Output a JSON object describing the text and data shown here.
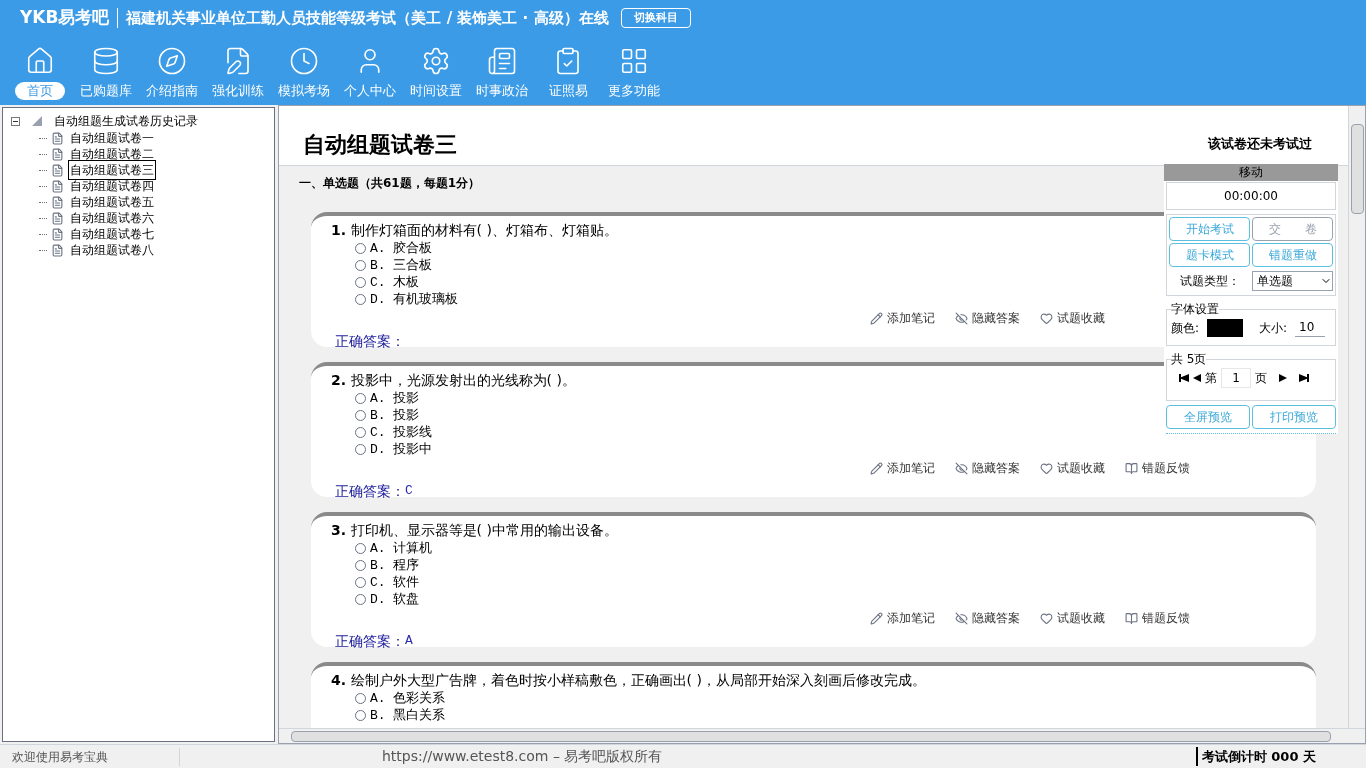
{
  "header": {
    "logo": "YKB易考吧",
    "title": "福建机关事业单位工勤人员技能等级考试（美工 / 装饰美工 · 高级）在线",
    "switch_button": "切换科目"
  },
  "nav": [
    {
      "label": "首页",
      "selected": true
    },
    {
      "label": "已购题库",
      "selected": false
    },
    {
      "label": "介绍指南",
      "selected": false
    },
    {
      "label": "强化训练",
      "selected": false
    },
    {
      "label": "模拟考场",
      "selected": false
    },
    {
      "label": "个人中心",
      "selected": false
    },
    {
      "label": "时间设置",
      "selected": false
    },
    {
      "label": "时事政治",
      "selected": false
    },
    {
      "label": "证照易",
      "selected": false
    },
    {
      "label": "更多功能",
      "selected": false
    }
  ],
  "tree": {
    "label": "自动组题生成试卷历史记录",
    "expanded": true,
    "children": [
      {
        "label": "自动组题试卷一",
        "selected": false
      },
      {
        "label": "自动组题试卷二",
        "selected": false
      },
      {
        "label": "自动组题试卷三",
        "selected": true
      },
      {
        "label": "自动组题试卷四",
        "selected": false
      },
      {
        "label": "自动组题试卷五",
        "selected": false
      },
      {
        "label": "自动组题试卷六",
        "selected": false
      },
      {
        "label": "自动组题试卷七",
        "selected": false
      },
      {
        "label": "自动组题试卷八",
        "selected": false
      }
    ]
  },
  "paper": {
    "title": "自动组题试卷三",
    "status": "该试卷还未考试过",
    "section": "一、单选题（共61题，每题1分）",
    "questions": [
      {
        "number": "1.",
        "text": "制作灯箱面的材料有( )、灯箱布、灯箱贴。",
        "options": [
          {
            "label": "A. 胶合板",
            "selected": false
          },
          {
            "label": "B. 三合板",
            "selected": false
          },
          {
            "label": "C. 木板",
            "selected": false
          },
          {
            "label": "D. 有机玻璃板",
            "selected": false
          }
        ],
        "actions": [
          "添加笔记",
          "隐藏答案",
          "试题收藏"
        ],
        "answer_label": "正确答案："
      },
      {
        "number": "2.",
        "text": "投影中，光源发射出的光线称为( )。",
        "options": [
          {
            "label": "A. 投影",
            "selected": false
          },
          {
            "label": "B. 投影",
            "selected": false
          },
          {
            "label": "C. 投影线",
            "selected": false
          },
          {
            "label": "D. 投影中",
            "selected": false
          }
        ],
        "actions": [
          "添加笔记",
          "隐藏答案",
          "试题收藏",
          "错题反馈"
        ],
        "answer_label": "正确答案：",
        "answer": "C"
      },
      {
        "number": "3.",
        "text": "打印机、显示器等是( )中常用的输出设备。",
        "options": [
          {
            "label": "A. 计算机",
            "selected": false
          },
          {
            "label": "B. 程序",
            "selected": false
          },
          {
            "label": "C. 软件",
            "selected": false
          },
          {
            "label": "D. 软盘",
            "selected": false
          }
        ],
        "actions": [
          "添加笔记",
          "隐藏答案",
          "试题收藏",
          "错题反馈"
        ],
        "answer_label": "正确答案：",
        "answer": "A"
      },
      {
        "number": "4.",
        "text": "绘制户外大型广告牌，着色时按小样稿敷色，正确画出( )，从局部开始深入刻画后修改完成。",
        "options": [
          {
            "label": "A. 色彩关系",
            "selected": false
          },
          {
            "label": "B. 黑白关系",
            "selected": false
          }
        ]
      }
    ]
  },
  "panel": {
    "move": "移动",
    "timer": "00:00:00",
    "buttons": [
      {
        "label": "开始考试",
        "disabled": false
      },
      {
        "label": "交　　卷",
        "disabled": true
      },
      {
        "label": "题卡模式",
        "disabled": false
      },
      {
        "label": "错题重做",
        "disabled": false
      }
    ],
    "type_label": "试题类型：",
    "type_value": "单选题",
    "font_group": "字体设置",
    "color_label": "颜色:",
    "size_label": "大小:",
    "size_value": "10",
    "pages_group": "共 5页",
    "page_prefix": "第",
    "page_value": "1",
    "page_suffix": "页",
    "bottom_buttons": [
      "全屏预览",
      "打印预览"
    ]
  },
  "status_bar": {
    "welcome": "欢迎使用易考宝典",
    "copyright": "https://www.etest8.com – 易考吧版权所有",
    "countdown": "考试倒计时 000 天"
  }
}
